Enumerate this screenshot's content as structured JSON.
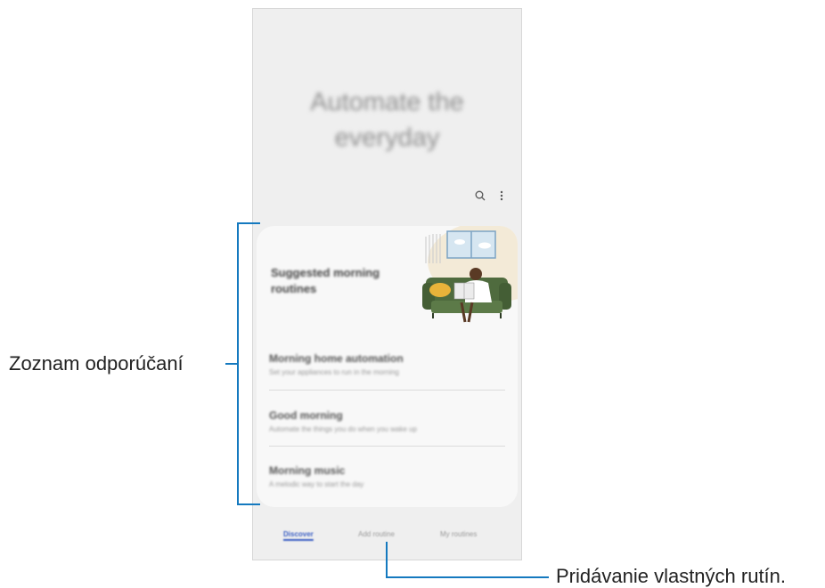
{
  "hero": {
    "line1": "Automate the",
    "line2": "everyday"
  },
  "toolbar": {
    "search_icon": "search-icon",
    "more_icon": "more-vertical-icon"
  },
  "card": {
    "title": "Suggested morning routines",
    "items": [
      {
        "title": "Morning home automation",
        "subtitle": "Set your appliances to run in the morning"
      },
      {
        "title": "Good morning",
        "subtitle": "Automate the things you do when you wake up"
      },
      {
        "title": "Morning music",
        "subtitle": "A melodic way to start the day"
      }
    ]
  },
  "tabs": [
    {
      "label": "Discover",
      "active": true
    },
    {
      "label": "Add routine",
      "active": false
    },
    {
      "label": "My routines",
      "active": false
    }
  ],
  "callouts": {
    "recommendations": "Zoznam odporúčaní",
    "add_custom": "Pridávanie vlastných rutín."
  },
  "colors": {
    "callout": "#1479bf",
    "accent": "#3b5fc4",
    "sofa": "#4f6b3e"
  }
}
